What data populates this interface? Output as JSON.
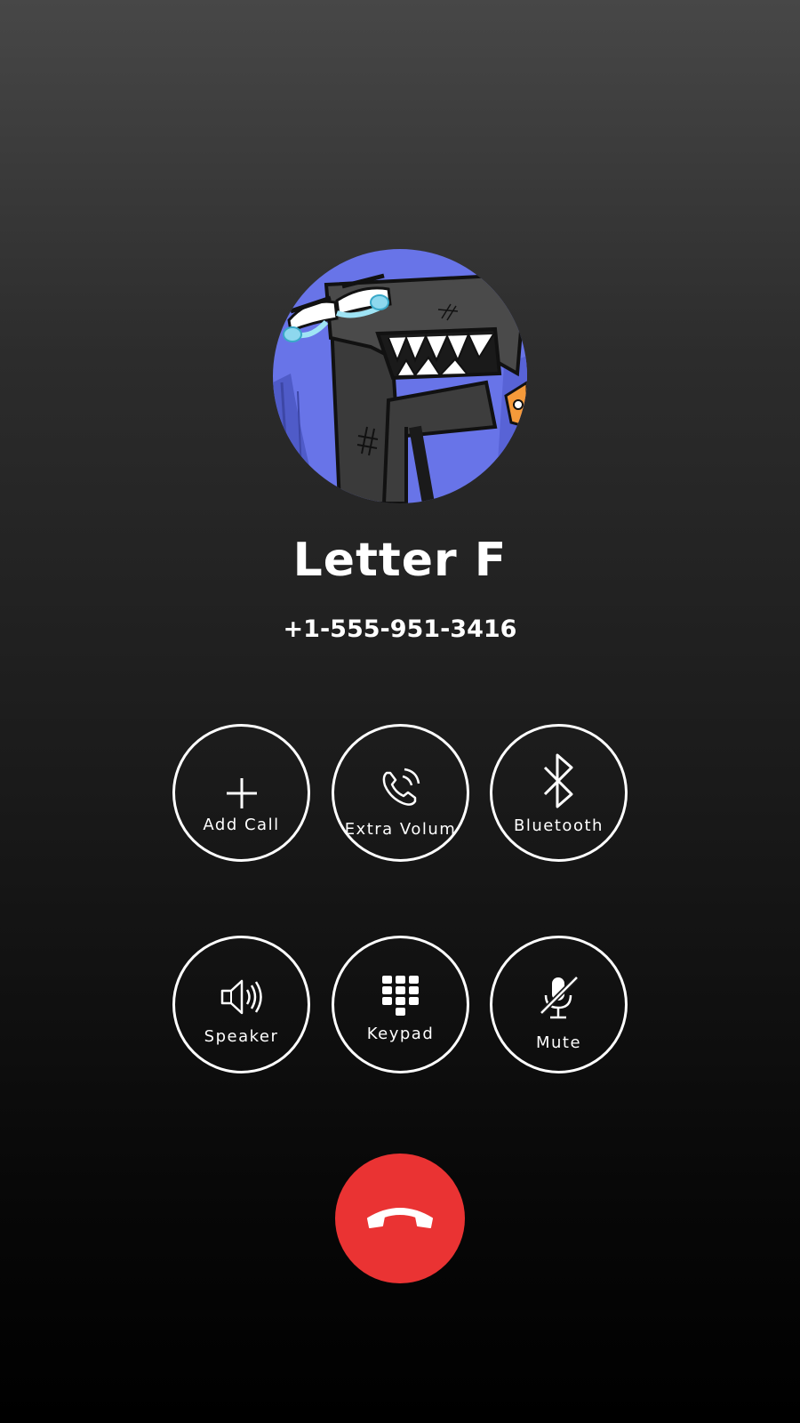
{
  "caller": {
    "name": "Letter F",
    "number": "+1-555-951-3416",
    "avatar_icon": "letter-f-character-avatar"
  },
  "controls": {
    "add_call": {
      "label": "Add Call",
      "icon": "plus-icon"
    },
    "extra_volume": {
      "label": "Extra Volum",
      "icon": "phone-volume-icon"
    },
    "bluetooth": {
      "label": "Bluetooth",
      "icon": "bluetooth-icon"
    },
    "speaker": {
      "label": "Speaker",
      "icon": "speaker-icon"
    },
    "keypad": {
      "label": "Keypad",
      "icon": "keypad-icon"
    },
    "mute": {
      "label": "Mute",
      "icon": "microphone-muted-icon"
    }
  },
  "end_call": {
    "icon": "hang-up-icon",
    "color": "#ea3333"
  },
  "colors": {
    "background_top": "#474747",
    "background_bottom": "#000000",
    "text": "#ffffff",
    "avatar_bg": "#6874e8"
  }
}
